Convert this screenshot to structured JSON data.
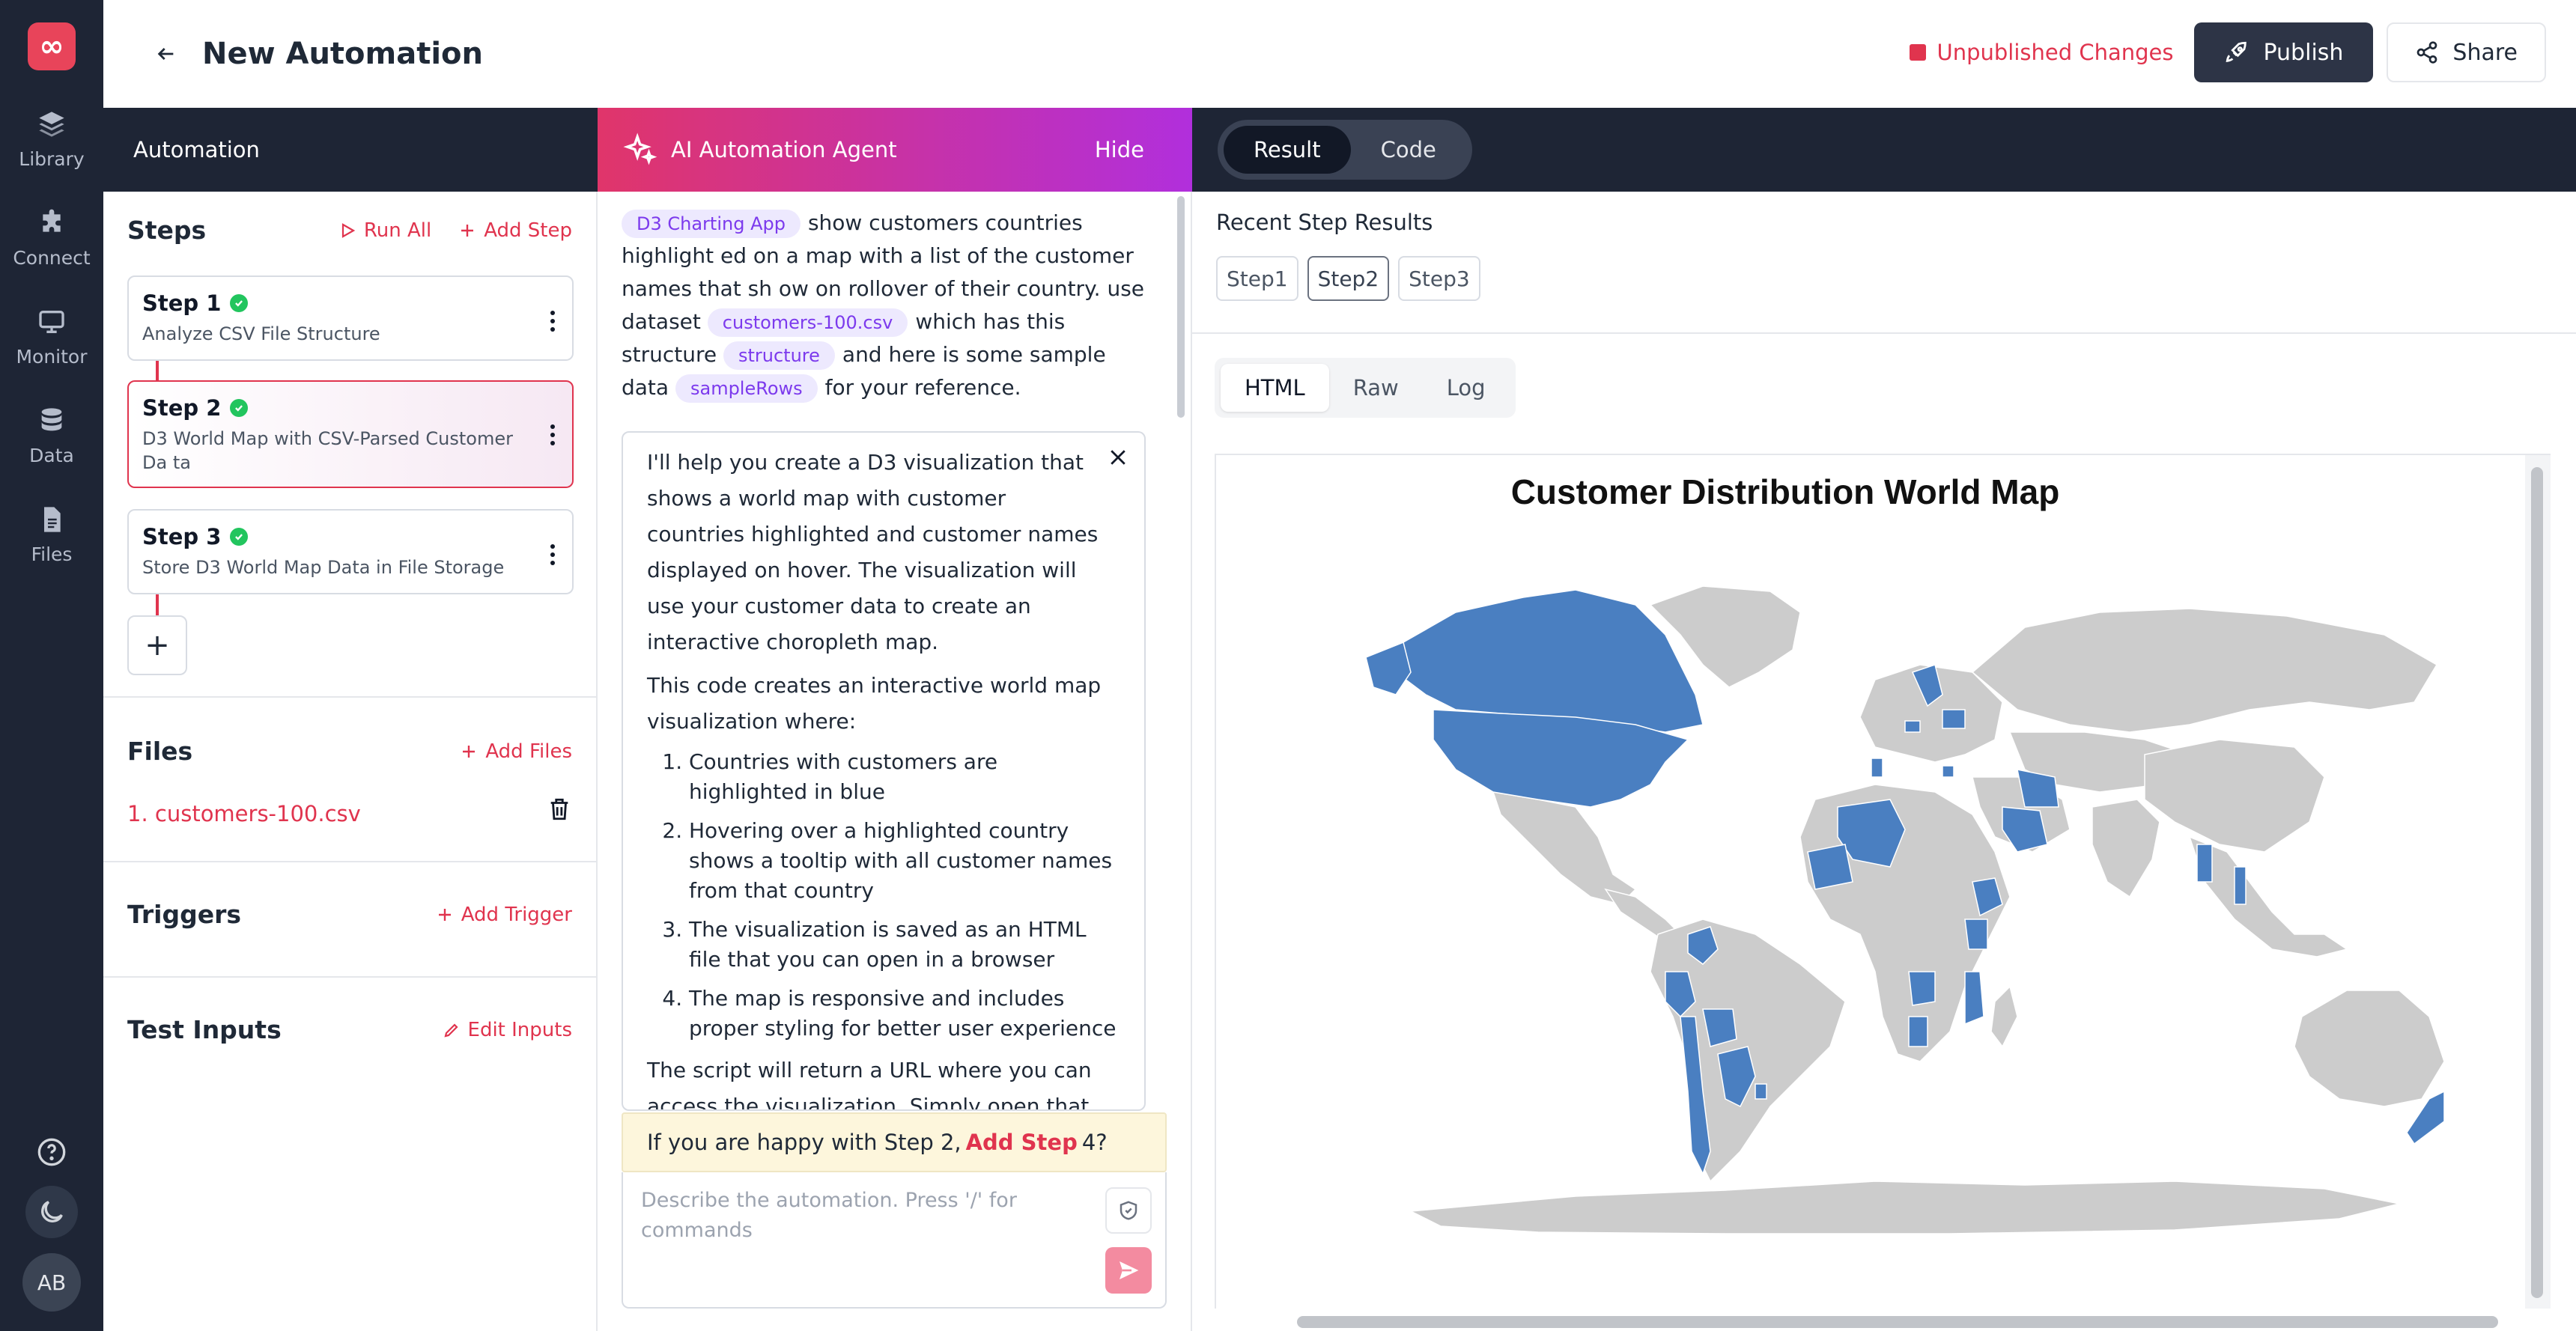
{
  "app": {
    "logo_glyph": "∞",
    "brand_color": "#e8445a"
  },
  "rail": {
    "items": [
      {
        "label": "Library",
        "icon": "layers-icon"
      },
      {
        "label": "Connect",
        "icon": "puzzle-icon"
      },
      {
        "label": "Monitor",
        "icon": "monitor-icon"
      },
      {
        "label": "Data",
        "icon": "database-icon"
      },
      {
        "label": "Files",
        "icon": "file-icon"
      }
    ],
    "help_icon": "help-icon",
    "theme_icon": "moon-icon",
    "avatar_initials": "AB"
  },
  "header": {
    "title": "New Automation",
    "status": "Unpublished Changes",
    "publish_label": "Publish",
    "share_label": "Share"
  },
  "automation": {
    "bar_title": "Automation",
    "steps_title": "Steps",
    "run_all_label": "Run All",
    "add_step_label": "Add Step",
    "steps": [
      {
        "title": "Step 1",
        "desc": "Analyze CSV File Structure"
      },
      {
        "title": "Step 2",
        "desc": "D3 World Map with CSV-Parsed Customer Da ta"
      },
      {
        "title": "Step 3",
        "desc": "Store D3 World Map Data in File Storage"
      }
    ],
    "add_glyph": "+",
    "files_title": "Files",
    "add_files_label": "Add Files",
    "files": [
      "1. customers-100.csv"
    ],
    "triggers_title": "Triggers",
    "add_trigger_label": "Add Trigger",
    "test_inputs_title": "Test Inputs",
    "edit_inputs_label": "Edit Inputs"
  },
  "agent": {
    "bar_title": "AI Automation Agent",
    "hide_label": "Hide",
    "prompt": {
      "chip1": "D3 Charting App",
      "text1": "show customers countries highlight ed on a map with a list of the customer names that sh ow on rollover of their country. use dataset",
      "chip2": "customers-100.csv",
      "text2": "which has this structure",
      "chip3": "structure",
      "text3": "and here is some sample data",
      "chip4": "sampleRows",
      "text4": "for your reference."
    },
    "reply": {
      "p1": "I'll help you create a D3 visualization that shows a world map with customer countries highlighted and customer names displayed on hover. The visualization will use your customer data to create an interactive choropleth map.",
      "p2": "This code creates an interactive world map visualization where:",
      "items": [
        "Countries with customers are highlighted in blue",
        "Hovering over a highlighted country shows a tooltip with all customer names from that country",
        "The visualization is saved as an HTML file that you can open in a browser",
        "The map is responsive and includes proper styling for better user experience"
      ],
      "p3": "The script will return a URL where you can access the visualization. Simply open that URL in a web browser to view the interactive map."
    },
    "nudge": {
      "pre": "If you are happy with Step 2,",
      "link": "Add Step",
      "post": "4?"
    },
    "composer_placeholder": "Describe the automation. Press '/' for commands"
  },
  "result": {
    "tabs": [
      "Result",
      "Code"
    ],
    "recent_title": "Recent Step Results",
    "step_chips": [
      "Step1",
      "Step2",
      "Step3"
    ],
    "view_tabs": [
      "HTML",
      "Raw",
      "Log"
    ],
    "map_title": "Customer Distribution World Map",
    "highlight_color": "#4a7fc1",
    "base_color": "#cccccc"
  }
}
